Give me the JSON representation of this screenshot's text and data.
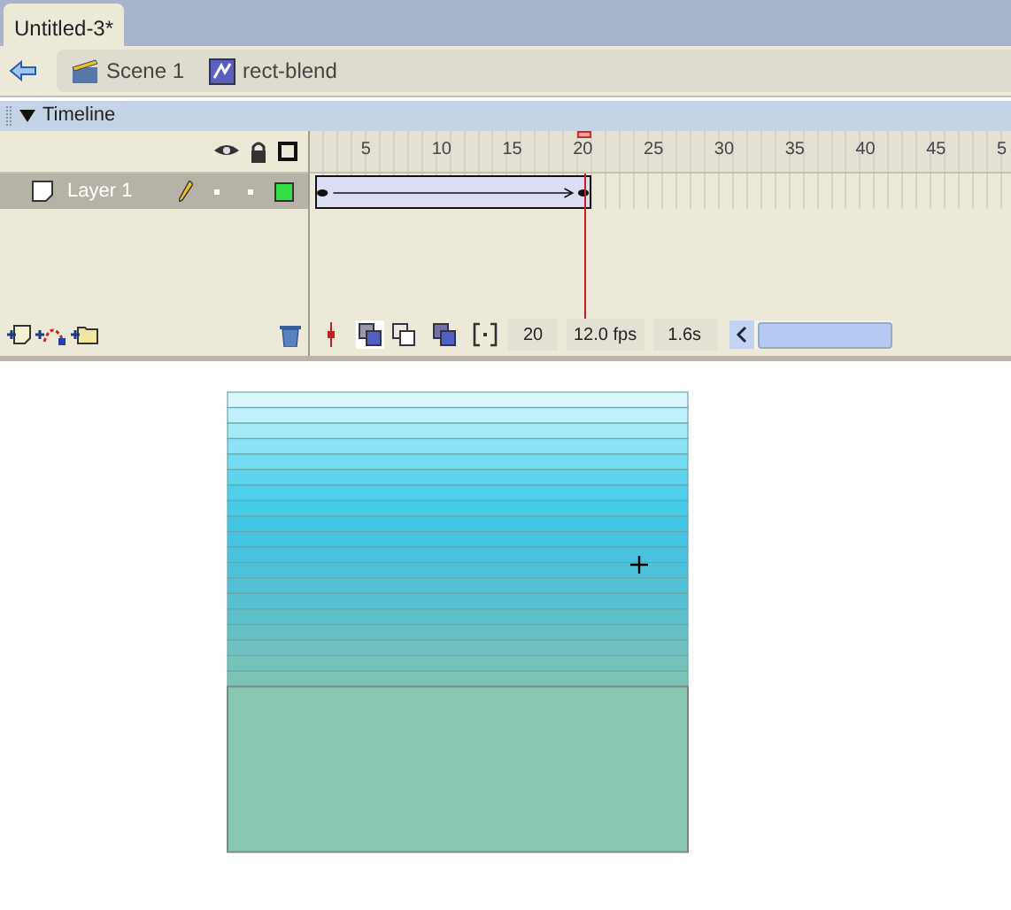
{
  "document_tab": {
    "title": "Untitled-3*",
    "selected": true
  },
  "breadcrumb": [
    {
      "kind": "scene",
      "label": "Scene 1"
    },
    {
      "kind": "symbol",
      "label": "rect-blend"
    }
  ],
  "timeline": {
    "title": "Timeline",
    "expanded": true,
    "ruler": [
      {
        "label": "5"
      },
      {
        "label": "10"
      },
      {
        "label": "15"
      },
      {
        "label": "20"
      },
      {
        "label": "25"
      },
      {
        "label": "30"
      },
      {
        "label": "35"
      },
      {
        "label": "40"
      },
      {
        "label": "45"
      },
      {
        "label": "5"
      }
    ],
    "layers": [
      {
        "name": "Layer 1",
        "selected": true,
        "editing": true,
        "color": "#33dd44"
      }
    ],
    "status": {
      "current_frame": "20",
      "frame_rate": "12.0 fps",
      "elapsed": "1.6s"
    }
  }
}
